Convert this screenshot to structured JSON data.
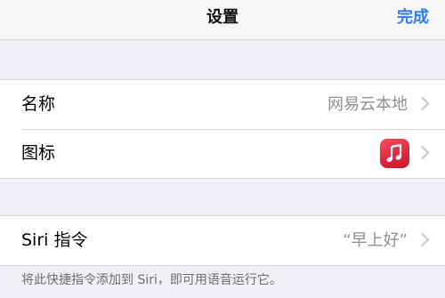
{
  "navbar": {
    "title": "设置",
    "done_label": "完成"
  },
  "settings": {
    "name_label": "名称",
    "name_value": "网易云本地",
    "icon_label": "图标",
    "icon_name": "music-note-icon",
    "icon_color": "#e0283f"
  },
  "siri": {
    "label": "Siri 指令",
    "value": "“早上好”",
    "footer": "将此快捷指令添加到 Siri，即可用语音运行它。"
  },
  "colors": {
    "accent": "#3478f6",
    "background": "#efeff4"
  }
}
